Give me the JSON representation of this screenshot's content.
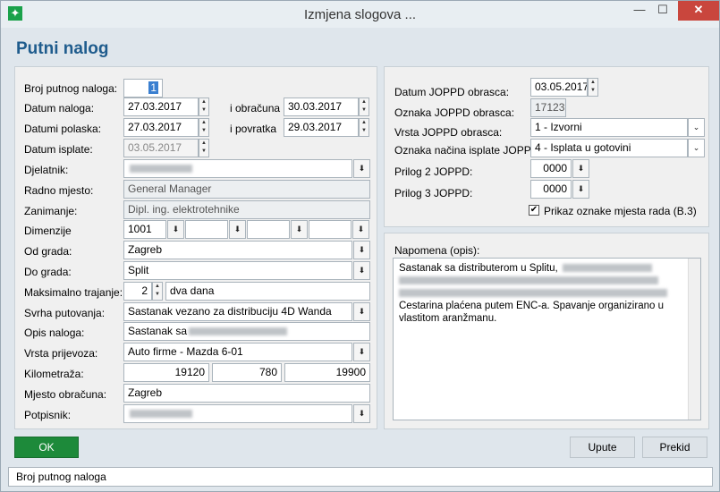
{
  "window": {
    "title": "Izmjena slogova ...",
    "min": "—",
    "max": "☐",
    "close": "✕"
  },
  "header": {
    "title": "Putni nalog"
  },
  "left": {
    "broj_label": "Broj putnog naloga:",
    "broj_value": "1",
    "datum_naloga_label": "Datum naloga:",
    "datum_naloga": "27.03.2017",
    "obracuna_label": "i obračuna",
    "obracuna": "30.03.2017",
    "polaska_label": "Datumi polaska:",
    "polaska": "27.03.2017",
    "povratka_label": "i povratka",
    "povratka": "29.03.2017",
    "isplate_label": "Datum isplate:",
    "isplate": "03.05.2017",
    "djelatnik_label": "Djelatnik:",
    "radno_label": "Radno mjesto:",
    "radno": "General Manager",
    "zanimanje_label": "Zanimanje:",
    "zanimanje": "Dipl. ing. elektrotehnike",
    "dimenzije_label": "Dimenzije",
    "dim1": "1001",
    "od_label": "Od grada:",
    "od": "Zagreb",
    "do_label": "Do grada:",
    "do": "Split",
    "trajanje_label": "Maksimalno trajanje:",
    "trajanje": "2",
    "trajanje_desc": "dva dana",
    "svrha_label": "Svrha putovanja:",
    "svrha": "Sastanak vezano za distribuciju 4D Wanda",
    "opis_label": "Opis naloga:",
    "opis": "Sastanak sa",
    "prijevoz_label": "Vrsta prijevoza:",
    "prijevoz": "Auto firme - Mazda 6-01",
    "km_label": "Kilometraža:",
    "km1": "19120",
    "km2": "780",
    "km3": "19900",
    "mjesto_label": "Mjesto obračuna:",
    "mjesto": "Zagreb",
    "potpisnik_label": "Potpisnik:"
  },
  "right": {
    "datum_joppd_label": "Datum JOPPD obrasca:",
    "datum_joppd": "03.05.2017",
    "oznaka_label": "Oznaka JOPPD obrasca:",
    "oznaka": "17123",
    "vrsta_label": "Vrsta JOPPD obrasca:",
    "vrsta": "1 - Izvorni",
    "nacin_label": "Oznaka načina isplate JOPPD:",
    "nacin": "4 - Isplata u gotovini",
    "prilog2_label": "Prilog 2 JOPPD:",
    "prilog2": "0000",
    "prilog3_label": "Prilog 3 JOPPD:",
    "prilog3": "0000",
    "prikaz_label": "Prikaz oznake mjesta rada (B.3)",
    "prikaz_checked": true,
    "napomena_label": "Napomena (opis):",
    "napomena_l1": "Sastanak sa distributerom u Splitu,",
    "napomena_l4": "Cestarina plaćena putem ENC-a. Spavanje organizirano u vlastitom aranžmanu."
  },
  "buttons": {
    "ok": "OK",
    "upute": "Upute",
    "prekid": "Prekid"
  },
  "status": {
    "text": "Broj putnog naloga"
  },
  "colors": {
    "accent": "#1f5c8d",
    "ok": "#1d8a3a",
    "close": "#c9463d"
  }
}
